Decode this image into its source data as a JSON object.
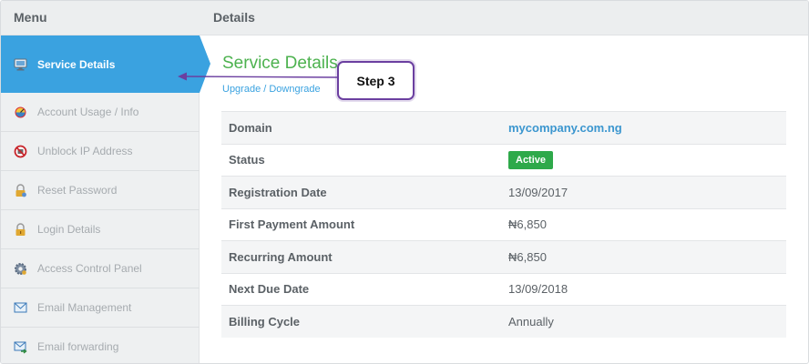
{
  "header": {
    "menu_title": "Menu",
    "details_title": "Details"
  },
  "sidebar": {
    "items": [
      {
        "label": "Service Details",
        "icon": "monitor-icon",
        "active": true
      },
      {
        "label": "Account Usage / Info",
        "icon": "gauge-icon"
      },
      {
        "label": "Unblock IP Address",
        "icon": "no-entry-icon"
      },
      {
        "label": "Reset Password",
        "icon": "lock-icon"
      },
      {
        "label": "Login Details",
        "icon": "padlock-icon"
      },
      {
        "label": "Access Control Panel",
        "icon": "gear-icon"
      },
      {
        "label": "Email Management",
        "icon": "envelope-icon"
      },
      {
        "label": "Email forwarding",
        "icon": "forward-mail-icon"
      }
    ]
  },
  "main": {
    "title": "Service Details",
    "upgrade_link": "Upgrade / Downgrade",
    "rows": [
      {
        "key": "Domain",
        "value": "mycompany.com.ng"
      },
      {
        "key": "Status",
        "value": "Active"
      },
      {
        "key": "Registration Date",
        "value": "13/09/2017"
      },
      {
        "key": "First Payment Amount",
        "value": "₦6,850"
      },
      {
        "key": "Recurring Amount",
        "value": "₦6,850"
      },
      {
        "key": "Next Due Date",
        "value": "13/09/2018"
      },
      {
        "key": "Billing Cycle",
        "value": "Annually"
      }
    ]
  },
  "annotation": {
    "step_label": "Step 3"
  },
  "colors": {
    "accent": "#3aa2e0",
    "title_green": "#4db24f",
    "status_green": "#2ea94a",
    "annotation_purple": "#6b3fa0"
  }
}
